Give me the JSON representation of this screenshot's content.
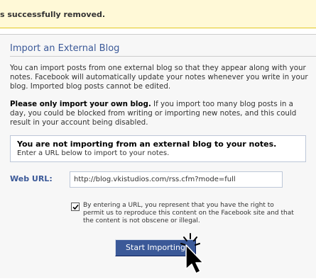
{
  "notice": {
    "text": "s successfully removed."
  },
  "section": {
    "title": "Import an External Blog"
  },
  "intro": {
    "text": "You can import posts from one external blog so that they appear along with your notes. Facebook will automatically update your notes whenever you write in your blog. Imported blog posts cannot be edited."
  },
  "warning": {
    "bold": "Please only import your own blog.",
    "text": " If you import too many blog posts in a day, you could be blocked from writing or importing new notes, and this could result in your account being disabled."
  },
  "status": {
    "title": "You are not importing from an external blog to your notes.",
    "subtitle": "Enter a URL below to import to your notes."
  },
  "form": {
    "url_label": "Web URL:",
    "url_value": "http://blog.vkistudios.com/rss.cfm?mode=full",
    "agree_checked": true,
    "agree_text": "By entering a URL, you represent that you have the right to permit us to reproduce this content on the Facebook site and that the content is not obscene or illegal.",
    "submit_label": "Start Importing"
  },
  "icons": {
    "cursor": "arrow-cursor-icon",
    "checkmark": "checkmark-icon"
  },
  "colors": {
    "brand": "#3b5998",
    "notice_bg": "#fff9d7",
    "notice_border": "#e2c822",
    "input_border": "#bdc7d8"
  }
}
